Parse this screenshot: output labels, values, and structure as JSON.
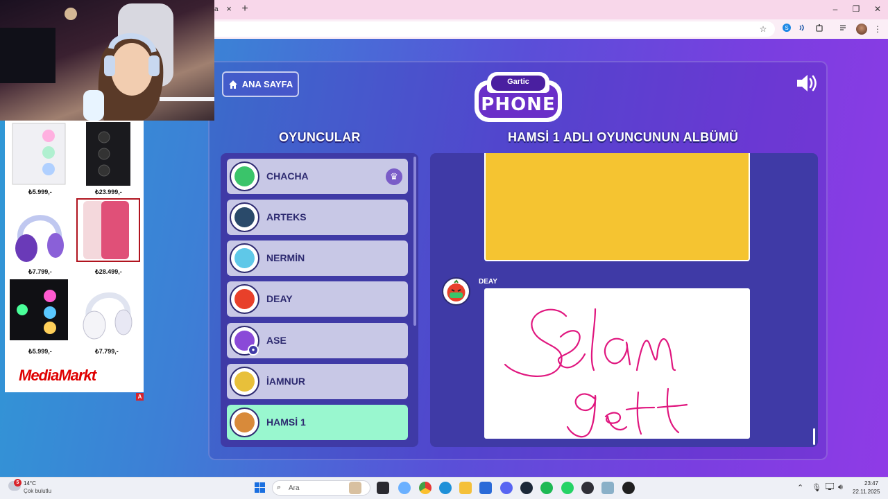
{
  "browser": {
    "tab_fragment": "a",
    "tab_close": "×",
    "new_tab": "+",
    "window_controls": [
      "–",
      "❐",
      "✕"
    ]
  },
  "game": {
    "home_button": "ANA SAYFA",
    "logo_top": "Gartic",
    "logo_main": "PHONE",
    "players_heading": "OYUNCULAR",
    "album_heading": "HAMSİ 1 ADLI OYUNCUNUN ALBÜMÜ",
    "players": [
      {
        "name": "CHACHA",
        "host": true,
        "active": false,
        "color": "#3ac46a"
      },
      {
        "name": "ARTEKS",
        "host": false,
        "active": false,
        "color": "#2a4a6a"
      },
      {
        "name": "NERMİN",
        "host": false,
        "active": false,
        "color": "#5fc8e8"
      },
      {
        "name": "DEAY",
        "host": false,
        "active": false,
        "color": "#e8402a"
      },
      {
        "name": "ASE",
        "host": false,
        "active": false,
        "color": "#8a4ad8"
      },
      {
        "name": "İAMNUR",
        "host": false,
        "active": false,
        "color": "#e8c03a"
      },
      {
        "name": "HAMSİ 1",
        "host": false,
        "active": true,
        "color": "#d88a3a"
      }
    ],
    "album": {
      "entry_author": "DEAY",
      "card_color": "#f5c431",
      "drawing_ink": "#e0177f"
    }
  },
  "overlay": {
    "ad_prices": [
      "₺5.999,-",
      "₺23.999,-",
      "₺7.799,-",
      "₺28.499,-",
      "₺5.999,-",
      "₺7.799,-"
    ],
    "brand": "MediaMarkt",
    "ad_mark": "A"
  },
  "taskbar": {
    "weather_temp": "14°C",
    "weather_desc": "Çok bulutlu",
    "weather_badge": "5",
    "search_placeholder": "Ara",
    "time": "23:47",
    "date": "22.11.2025"
  }
}
